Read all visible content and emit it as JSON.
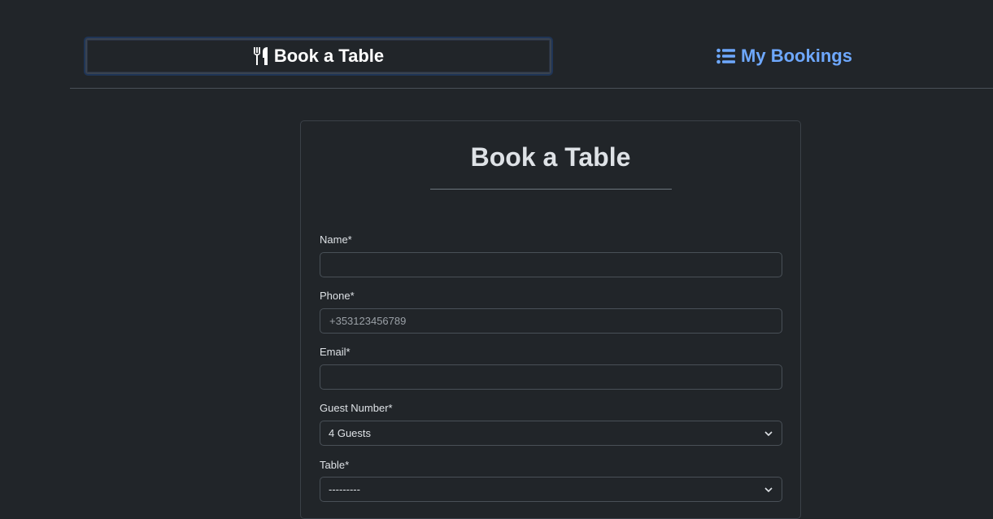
{
  "nav": {
    "tabs": [
      {
        "label": "Book a Table",
        "icon": "utensils-icon",
        "active": true
      },
      {
        "label": "My Bookings",
        "icon": "list-icon",
        "active": false
      }
    ]
  },
  "colors": {
    "background": "#212529",
    "link": "#6ea8fe",
    "text": "#dee2e6"
  },
  "form": {
    "title": "Book a Table",
    "fields": {
      "name": {
        "label": "Name*",
        "value": "",
        "placeholder": ""
      },
      "phone": {
        "label": "Phone*",
        "value": "",
        "placeholder": "+353123456789"
      },
      "email": {
        "label": "Email*",
        "value": "",
        "placeholder": ""
      },
      "guests": {
        "label": "Guest Number*",
        "selected": "4 Guests"
      },
      "table": {
        "label": "Table*",
        "selected": "---------"
      }
    }
  }
}
